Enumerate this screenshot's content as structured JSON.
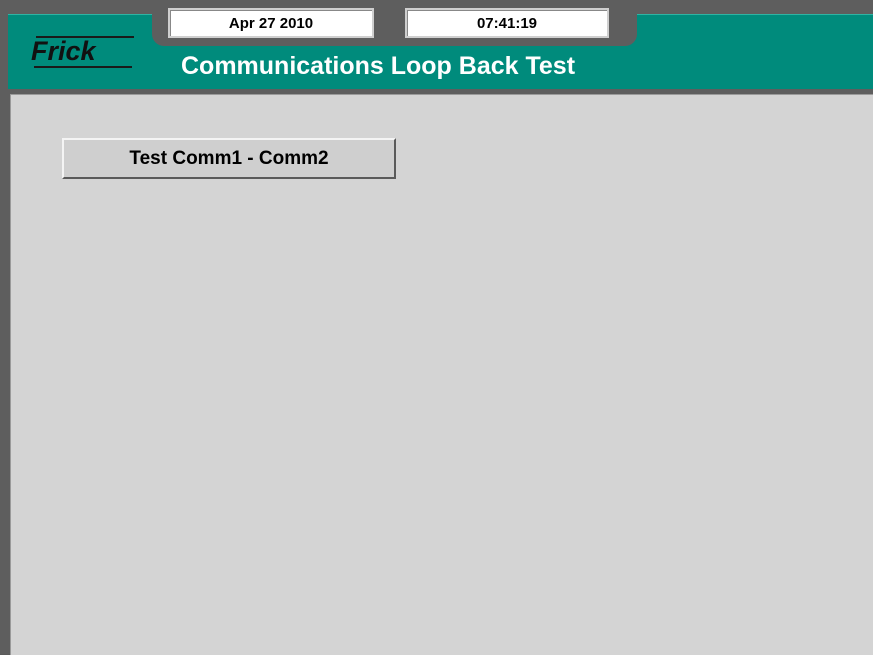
{
  "header": {
    "logo_text": "Frick",
    "title": "Communications Loop Back Test",
    "date": "Apr 27 2010",
    "time": "07:41:19"
  },
  "main": {
    "test_button_label": "Test Comm1 - Comm2"
  },
  "colors": {
    "header_teal": "#008b7c",
    "frame_gray": "#5e5e5e",
    "content_gray": "#d4d4d4"
  }
}
